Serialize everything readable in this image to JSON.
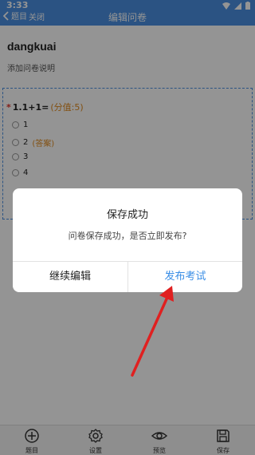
{
  "status_bar": {
    "time": "3:33"
  },
  "nav": {
    "back_label": "题目",
    "close_label": "关闭",
    "title": "编辑问卷"
  },
  "survey": {
    "title": "dangkuai",
    "description": "添加问卷说明"
  },
  "question": {
    "required_mark": "*",
    "text": "1.1+1=",
    "score": "(分值:5)",
    "options": [
      {
        "label": "1",
        "answer_tag": ""
      },
      {
        "label": "2",
        "answer_tag": "(答案)"
      },
      {
        "label": "3",
        "answer_tag": ""
      },
      {
        "label": "4",
        "answer_tag": ""
      }
    ]
  },
  "dialog": {
    "title": "保存成功",
    "message": "问卷保存成功，是否立即发布?",
    "continue_label": "继续编辑",
    "publish_label": "发布考试"
  },
  "bottom_tabs": [
    {
      "label": "题目",
      "icon": "plus-circle-icon"
    },
    {
      "label": "设置",
      "icon": "gear-icon"
    },
    {
      "label": "预览",
      "icon": "eye-icon"
    },
    {
      "label": "保存",
      "icon": "save-icon"
    }
  ],
  "colors": {
    "accent": "#4a90e2",
    "publish": "#3a8ee6",
    "arrow": "#e02020",
    "score": "#e08a1e"
  }
}
